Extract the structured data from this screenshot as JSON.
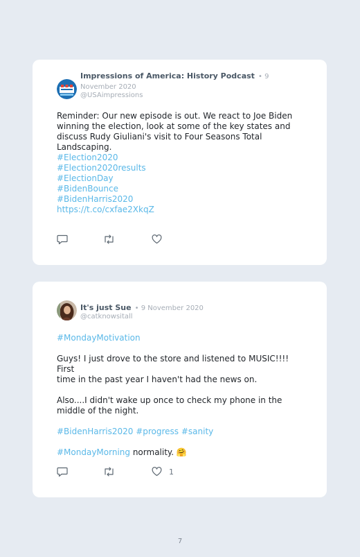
{
  "tweets": [
    {
      "author": "Impressions of America: History Podcast",
      "date": "• 9 November 2020",
      "handle": "@USAimpressions",
      "text_lines": [
        "Reminder: Our new episode is out. We react to Joe Biden",
        "winning the election, look at some of the key states and",
        "discuss Rudy Giuliani's visit to Four Seasons Total",
        "Landscaping."
      ],
      "hashtags": [
        "#Election2020",
        "#Election2020results",
        "#ElectionDay",
        "#BidenBounce",
        "#BidenHarris2020"
      ],
      "link": "https://t.co/cxfae2XkqZ",
      "likes": ""
    },
    {
      "author": "It's just Sue",
      "date": "• 9 November 2020",
      "handle": "@catknowsitall",
      "hashtag_top": "#MondayMotivation",
      "para1": [
        "Guys! I just drove to the store and listened to MUSIC!!!! First",
        "time in the past year I haven't had the news on."
      ],
      "para2": [
        "Also....I didn't wake up once to check my phone in the",
        "middle of the night."
      ],
      "tags_line": "#BidenHarris2020 #progress #sanity",
      "last_tag": "#MondayMorning",
      "last_text": " normality. 🤗",
      "likes": "1"
    }
  ],
  "page_number": "7",
  "colors": {
    "background": "#e6ebf2",
    "card": "#ffffff",
    "hashtag": "#5ab8e8",
    "icon": "#5b6670"
  },
  "icons": [
    "reply-icon",
    "retweet-icon",
    "like-icon"
  ]
}
